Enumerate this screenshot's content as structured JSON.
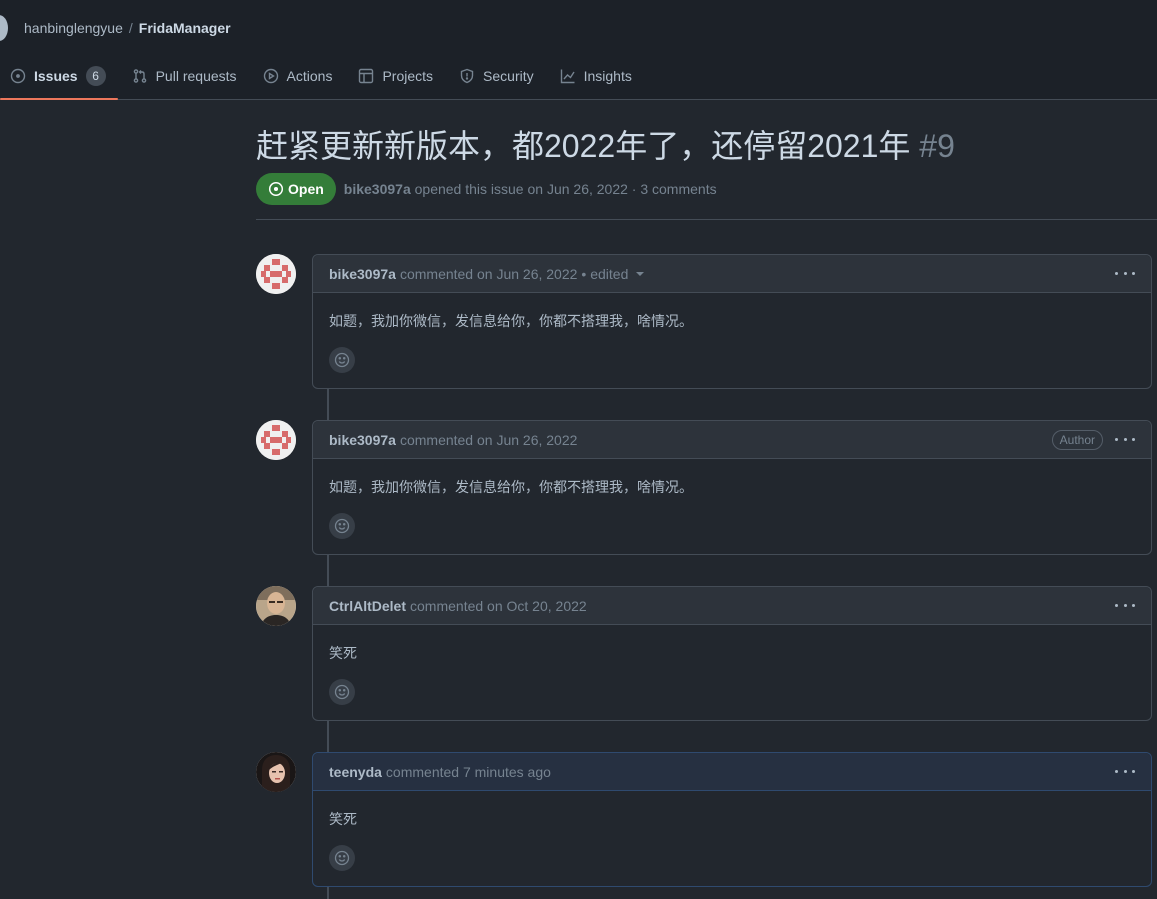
{
  "repo": {
    "owner": "hanbinglengyue",
    "separator": "/",
    "name": "FridaManager"
  },
  "tabs": [
    {
      "label": "Issues",
      "icon": "issue-opened-icon",
      "counter": "6",
      "selected": true
    },
    {
      "label": "Pull requests",
      "icon": "git-pull-request-icon"
    },
    {
      "label": "Actions",
      "icon": "play-icon"
    },
    {
      "label": "Projects",
      "icon": "table-icon"
    },
    {
      "label": "Security",
      "icon": "shield-icon"
    },
    {
      "label": "Insights",
      "icon": "graph-icon"
    }
  ],
  "issue": {
    "title": "赶紧更新新版本，都2022年了，还停留2021年",
    "number": "#9",
    "state": "Open",
    "author": "bike3097a",
    "meta_text": "opened this issue on Jun 26, 2022 · 3 comments"
  },
  "comments": [
    {
      "author": "bike3097a",
      "when": "commented on Jun 26, 2022",
      "edited": "• edited",
      "body": "如题，我加你微信，发信息给你，你都不搭理我，啥情况。",
      "avatar": "identicon-red"
    },
    {
      "author": "bike3097a",
      "when": "commented on Jun 26, 2022",
      "label": "Author",
      "body": "如题，我加你微信，发信息给你，你都不搭理我，啥情况。",
      "avatar": "identicon-red"
    },
    {
      "author": "CtrlAltDelet",
      "when": "commented on Oct 20, 2022",
      "body": "笑死",
      "avatar": "photo-man"
    },
    {
      "author": "teenyda",
      "when": "commented 7 minutes ago",
      "body": "笑死",
      "avatar": "photo-woman"
    }
  ],
  "colors": {
    "background": "#22272e",
    "open_badge": "#347d39",
    "tab_underline": "#ec775c"
  }
}
